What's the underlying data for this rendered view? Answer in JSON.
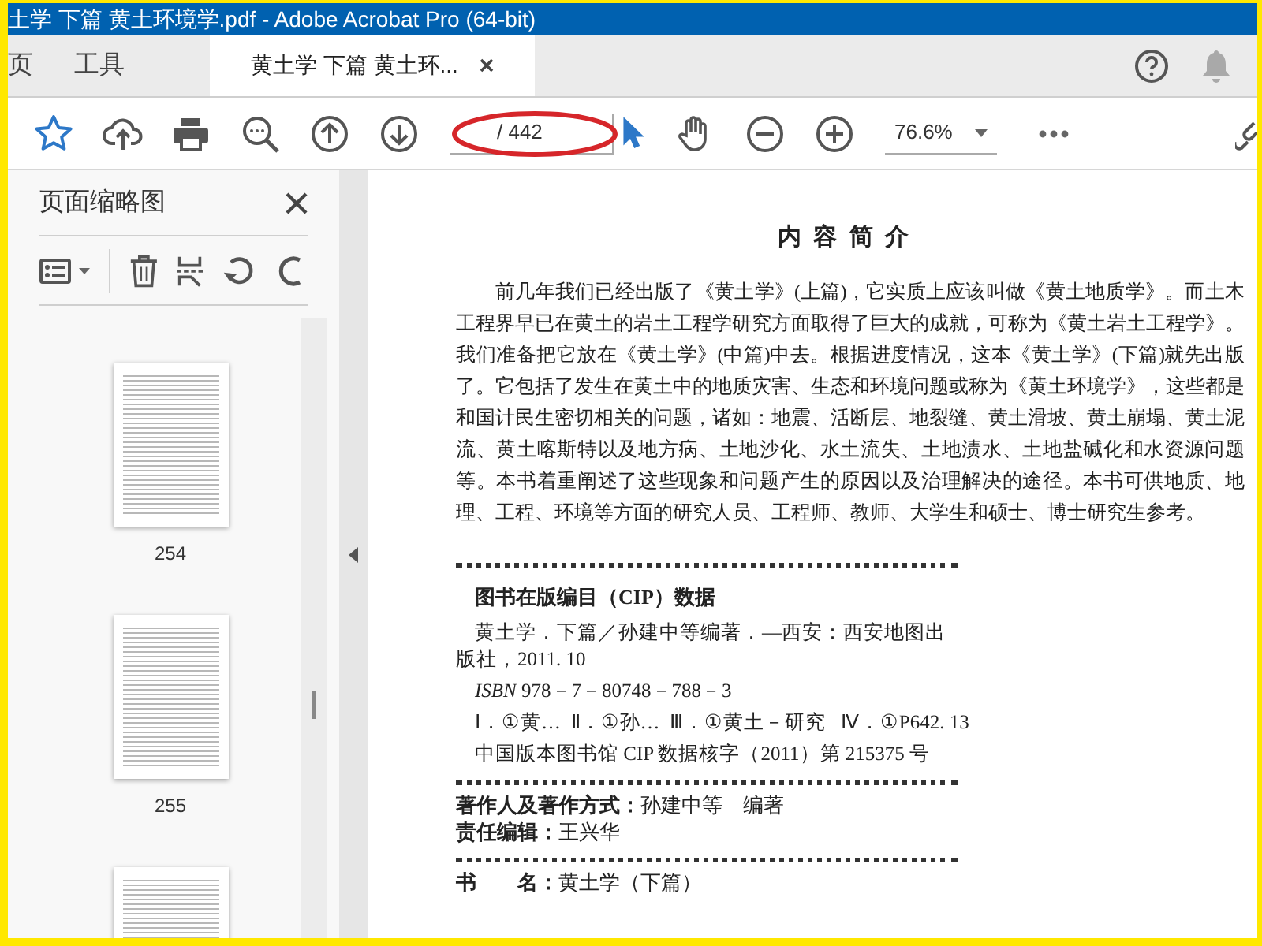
{
  "window": {
    "title": "土学 下篇 黄土环境学.pdf - Adobe Acrobat Pro (64-bit)"
  },
  "tabs": [
    {
      "label": "页",
      "kind": "nav",
      "selected": false
    },
    {
      "label": "工具",
      "kind": "nav",
      "selected": false
    },
    {
      "label": "黄土学 下篇 黄土环...",
      "kind": "document",
      "selected": true
    }
  ],
  "toolbar": {
    "page_total": "/ 442",
    "tools": [
      {
        "kind": "select",
        "selected": true
      },
      {
        "kind": "hand",
        "selected": false
      }
    ],
    "zoom": "76.6%"
  },
  "thumbnails_panel": {
    "title": "页面缩略图",
    "pages": [
      {
        "kind": "page",
        "label": "254"
      },
      {
        "kind": "page",
        "label": "255"
      },
      {
        "kind": "page"
      }
    ]
  },
  "document": {
    "title": "内 容 简 介",
    "paragraph": "前几年我们已经出版了《黄土学》(上篇)，它实质上应该叫做《黄土地质学》。而土木工程界早已在黄土的岩土工程学研究方面取得了巨大的成就，可称为《黄土岩土工程学》。我们准备把它放在《黄土学》(中篇)中去。根据进度情况，这本《黄土学》(下篇)就先出版了。它包括了发生在黄土中的地质灾害、生态和环境问题或称为《黄土环境学》，这些都是和国计民生密切相关的问题，诸如：地震、活断层、地裂缝、黄土滑坡、黄土崩塌、黄土泥流、黄土喀斯特以及地方病、土地沙化、水土流失、土地渍水、土地盐碱化和水资源问题等。本书着重阐述了这些现象和问题产生的原因以及治理解决的途径。本书可供地质、地理、工程、环境等方面的研究人员、工程师、教师、大学生和硕士、博士研究生参考。",
    "cip_heading": "图书在版编目（CIP）数据",
    "cip_lines": [
      {
        "kind": "wrap",
        "text": "黄土学．下篇／孙建中等编著．—西安：西安地图出版社，2011. 10"
      },
      {
        "kind": "indent",
        "text": "*ISBN* 978－7－80748－788－3"
      },
      {
        "kind": "indent",
        "text": "Ⅰ．①黄…  Ⅱ．①孙…  Ⅲ．①黄土－研究   Ⅳ．①P642. 13"
      },
      {
        "kind": "indent",
        "text": "中国版本图书馆 CIP 数据核字（2011）第 215375 号"
      }
    ],
    "credits": [
      {
        "label": "著作人及著作方式：",
        "value": "孙建中等　编著"
      },
      {
        "label": "责任编辑：",
        "value": "王兴华"
      }
    ],
    "book_info": [
      {
        "label": "书　　名：",
        "value": "黄土学（下篇）"
      }
    ]
  }
}
